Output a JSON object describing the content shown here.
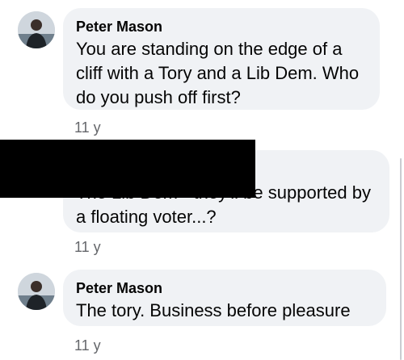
{
  "comments": [
    {
      "author": "Peter Mason",
      "text": "You are standing on the edge of a cliff with a Tory and a Lib Dem. Who do you push off first?",
      "time": "11 y"
    },
    {
      "author": "",
      "text": "The Lib Dem - they'll be supported by a floating voter...?",
      "time": "11 y"
    },
    {
      "author": "Peter Mason",
      "text": "The tory. Business before pleasure",
      "time": "11 y"
    }
  ],
  "colors": {
    "bubble": "#f0f2f5",
    "text": "#050505",
    "meta": "#65676b",
    "redaction": "#000000"
  }
}
